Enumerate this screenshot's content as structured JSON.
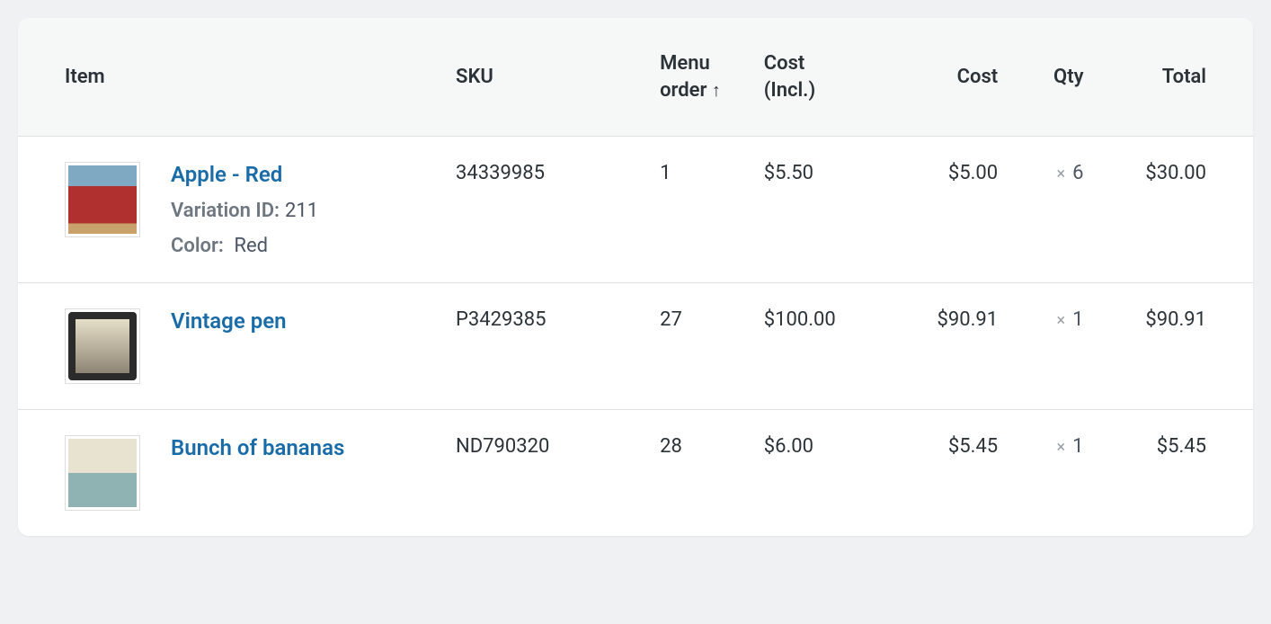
{
  "headers": {
    "item": "Item",
    "sku": "SKU",
    "menu_order_line1": "Menu",
    "menu_order_line2": "order",
    "sort_arrow": "↑",
    "cost_incl_line1": "Cost",
    "cost_incl_line2": "(Incl.)",
    "cost": "Cost",
    "qty": "Qty",
    "total": "Total"
  },
  "meta_labels": {
    "variation_id": "Variation ID:",
    "color": "Color:"
  },
  "qty_prefix": "×",
  "rows": [
    {
      "name": "Apple - Red",
      "thumb_class": "thumb-apple",
      "sku": "34339985",
      "menu_order": "1",
      "cost_incl": "$5.50",
      "cost": "$5.00",
      "qty": "6",
      "total": "$30.00",
      "variation_id": "211",
      "color": "Red"
    },
    {
      "name": "Vintage pen",
      "thumb_class": "thumb-pen",
      "sku": "P3429385",
      "menu_order": "27",
      "cost_incl": "$100.00",
      "cost": "$90.91",
      "qty": "1",
      "total": "$90.91"
    },
    {
      "name": "Bunch of bananas",
      "thumb_class": "thumb-lamp",
      "sku": "ND790320",
      "menu_order": "28",
      "cost_incl": "$6.00",
      "cost": "$5.45",
      "qty": "1",
      "total": "$5.45"
    }
  ]
}
